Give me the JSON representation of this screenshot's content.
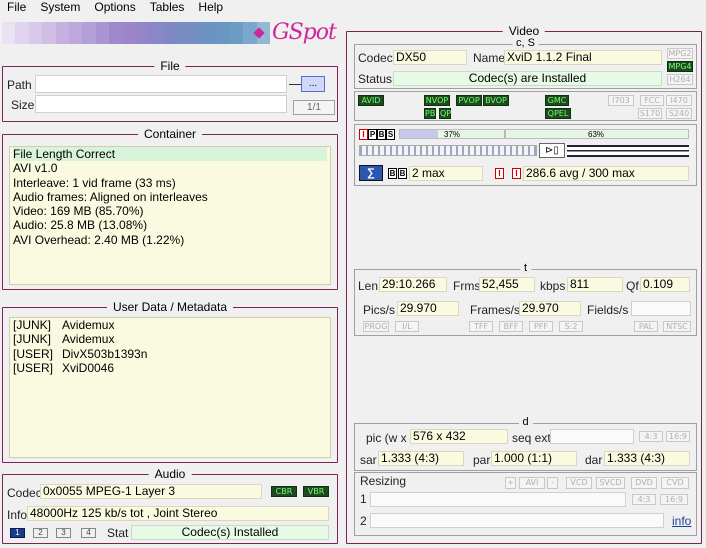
{
  "menu": [
    "File",
    "System",
    "Options",
    "Tables",
    "Help"
  ],
  "logo": "GSpot",
  "banner_colors": [
    "#e8e2f2",
    "#e0d4ee",
    "#d8c8ea",
    "#d0bee6",
    "#c6b0e0",
    "#bca8dc",
    "#b4a0d8",
    "#aa94d4",
    "#a088cc",
    "#9c86c8",
    "#9484c8",
    "#8a86c8",
    "#8088c4",
    "#7a8cc4",
    "#7290c2",
    "#6c94c2",
    "#6898c2",
    "#6c9cc4",
    "#7aa8cc",
    "#94b8d4"
  ],
  "file": {
    "title": "File",
    "path_label": "Path",
    "size_label": "Size",
    "browse_label": "...",
    "counter": "1/1"
  },
  "container": {
    "title": "Container",
    "lines": [
      "File Length Correct",
      "AVI v1.0",
      "Interleave: 1 vid frame (33 ms)",
      "Audio frames: Aligned on interleaves",
      "Video: 169 MB (85.70%)",
      "Audio: 25.8 MB (13.08%)",
      "AVI Overhead: 2.40 MB (1.22%)"
    ]
  },
  "userdata": {
    "title": "User Data / Metadata",
    "rows": [
      {
        "tag": "[JUNK]",
        "value": "Avidemux"
      },
      {
        "tag": "[JUNK]",
        "value": "Avidemux"
      },
      {
        "tag": "[USER]",
        "value": "DivX503b1393n"
      },
      {
        "tag": "[USER]",
        "value": "XviD0046"
      }
    ]
  },
  "audio": {
    "title": "Audio",
    "codec_label": "Codec",
    "codec_value": "0x0055 MPEG-1 Layer 3",
    "cbr": "CBR",
    "vbr": "VBR",
    "info_label": "Info",
    "info_value": "48000Hz  125 kb/s tot , Joint Stereo",
    "tabs": [
      "1",
      "2",
      "3",
      "4"
    ],
    "stat_label": "Stat",
    "stat_value": "Codec(s) Installed"
  },
  "video": {
    "title": "Video",
    "cs_title": "c, S",
    "codec_label": "Codec",
    "codec_value": "DX50",
    "name_label": "Name",
    "name_value": "XviD 1.1.2 Final",
    "status_label": "Status",
    "status_value": "Codec(s) are Installed",
    "fmt_tags": [
      "MPG2",
      "MPG4",
      "H264"
    ],
    "fmt_active": [
      false,
      true,
      false
    ],
    "row1_tags": [
      {
        "label": "AVID",
        "on": true
      },
      {
        "label": "NVOP",
        "on": true
      },
      {
        "label": "PVOP",
        "on": true
      },
      {
        "label": "BVOP",
        "on": true
      },
      {
        "label": "GMC",
        "on": true
      },
      {
        "label": "I703",
        "on": false
      },
      {
        "label": "FCC",
        "on": false
      },
      {
        "label": "I470",
        "on": false
      }
    ],
    "row2_tags": [
      {
        "label": "PB",
        "on": true
      },
      {
        "label": "QP",
        "on": true
      },
      {
        "label": "QPEL",
        "on": true
      },
      {
        "label": "S170",
        "on": false
      },
      {
        "label": "S240",
        "on": false
      }
    ],
    "frame_types": [
      "I",
      "P",
      "B",
      "S"
    ],
    "bar1_pct": "37%",
    "bar1_fill": 0.37,
    "bar2_pct": "63%",
    "bar2_fill": 0.63,
    "b_labels": [
      "B",
      "B"
    ],
    "max_b": "2 max",
    "bitrate": "286.6 avg / 300 max"
  },
  "t": {
    "title": "t",
    "len_label": "Len",
    "len_value": "29:10.266",
    "frms_label": "Frms",
    "frms_value": "52,455",
    "kbps_label": "kbps",
    "kbps_value": "811",
    "qf_label": "Qf",
    "qf_value": "0.109",
    "pics_label": "Pics/s",
    "pics_value": "29.970",
    "frames_label": "Frames/s",
    "frames_value": "29.970",
    "fields_label": "Fields/s",
    "tags": [
      "PROG",
      "I/L",
      "TFF",
      "BFF",
      "PFF",
      "S:2",
      "PAL",
      "NTSC"
    ]
  },
  "d": {
    "title": "d",
    "pic_label": "pic (w x",
    "pic_value": "576 x 432",
    "seq_label": "seq ext",
    "aspect_tags": [
      "4:3",
      "16:9"
    ],
    "sar_label": "sar",
    "sar_value": "1.333 (4:3)",
    "par_label": "par",
    "par_value": "1.000 (1:1)",
    "dar_label": "dar",
    "dar_value": "1.333 (4:3)"
  },
  "resizing": {
    "label": "Resizing",
    "buttons": [
      "+",
      "AVI",
      "-",
      "VCD",
      "SVCD",
      "DVD",
      "CVD"
    ],
    "aspect_tags": [
      "4:3",
      "16:9"
    ],
    "row1": "1",
    "row2": "2",
    "info_link": "info"
  }
}
